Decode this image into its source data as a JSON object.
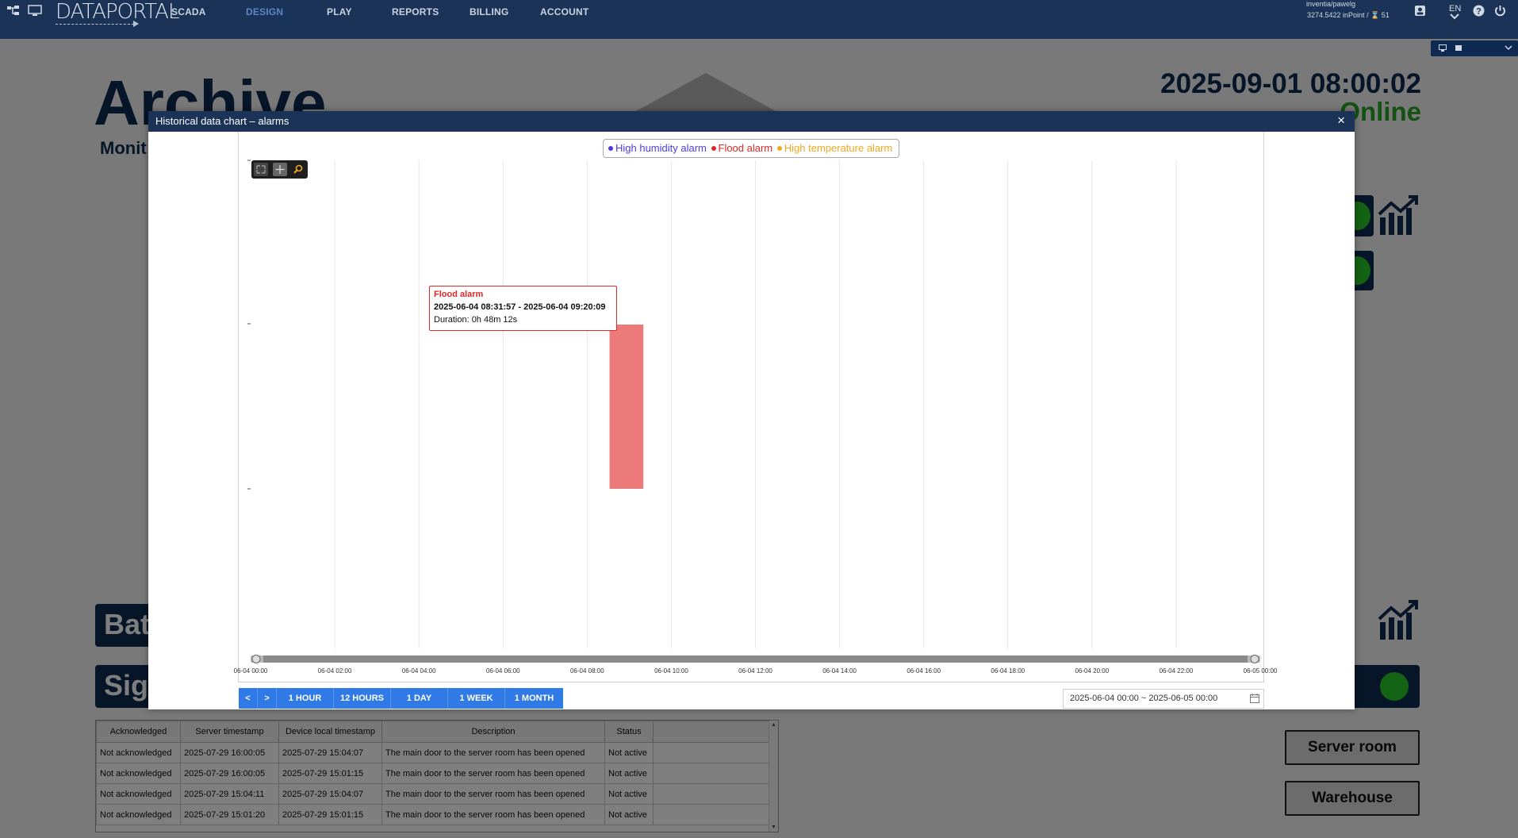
{
  "topbar": {
    "logo": "DATAPORTAL",
    "nav": [
      "SCADA",
      "DESIGN",
      "PLAY",
      "REPORTS",
      "BILLING",
      "ACCOUNT"
    ],
    "active_nav": "DESIGN",
    "user": "inventia/pawelg",
    "balance": "3274.5422 inPoint / ⌛ 51",
    "language": "EN"
  },
  "page": {
    "title": "Archive",
    "subtitle": "Monit",
    "datetime": "2025-09-01 08:00:02",
    "status": "Online",
    "panel_bat": "Bat",
    "panel_sig": "Sig",
    "panel_right_fragment": "r",
    "room_buttons": [
      "Server room",
      "Warehouse"
    ]
  },
  "alarm_table": {
    "columns": [
      "Acknowledged",
      "Server timestamp",
      "Device local timestamp",
      "Description",
      "Status"
    ],
    "rows": [
      [
        "Not acknowledged",
        "2025-07-29 16:00:05",
        "2025-07-29 15:04:07",
        "The main door to the server room has been opened",
        "Not active"
      ],
      [
        "Not acknowledged",
        "2025-07-29 16:00:05",
        "2025-07-29 15:01:15",
        "The main door to the server room has been opened",
        "Not active"
      ],
      [
        "Not acknowledged",
        "2025-07-29 15:04:11",
        "2025-07-29 15:04:07",
        "The main door to the server room has been opened",
        "Not active"
      ],
      [
        "Not acknowledged",
        "2025-07-29 15:01:20",
        "2025-07-29 15:01:15",
        "The main door to the server room has been opened",
        "Not active"
      ]
    ]
  },
  "modal": {
    "title": "Historical data chart – alarms",
    "close_label": "×",
    "range_buttons": [
      "<",
      ">",
      "1 HOUR",
      "12 HOURS",
      "1 DAY",
      "1 WEEK",
      "1 MONTH"
    ],
    "date_range": "2025-06-04 00:00 ~ 2025-06-05 00:00"
  },
  "chart_data": {
    "type": "bar",
    "chart_subtype": "timeline",
    "legend_position": "top-center",
    "grid": true,
    "x_range": [
      "2025-06-04 00:00",
      "2025-06-05 00:00"
    ],
    "x_tick_labels": [
      "06-04 00:00",
      "06-04 02:00",
      "06-04 04:00",
      "06-04 06:00",
      "06-04 08:00",
      "06-04 10:00",
      "06-04 12:00",
      "06-04 14:00",
      "06-04 16:00",
      "06-04 18:00",
      "06-04 20:00",
      "06-04 22:00",
      "06-05 00:00"
    ],
    "series": [
      {
        "name": "High humidity alarm",
        "color": "#4b3de6",
        "events": []
      },
      {
        "name": "Flood alarm",
        "color": "#e02828",
        "events": [
          {
            "start": "2025-06-04 08:31:57",
            "end": "2025-06-04 09:20:09"
          }
        ]
      },
      {
        "name": "High temperature alarm",
        "color": "#f2a81d",
        "events": []
      }
    ],
    "tooltip": {
      "series": "Flood alarm",
      "range": "2025-06-04 08:31:57 - 2025-06-04 09:20:09",
      "duration": "Duration: 0h 48m 12s"
    }
  }
}
